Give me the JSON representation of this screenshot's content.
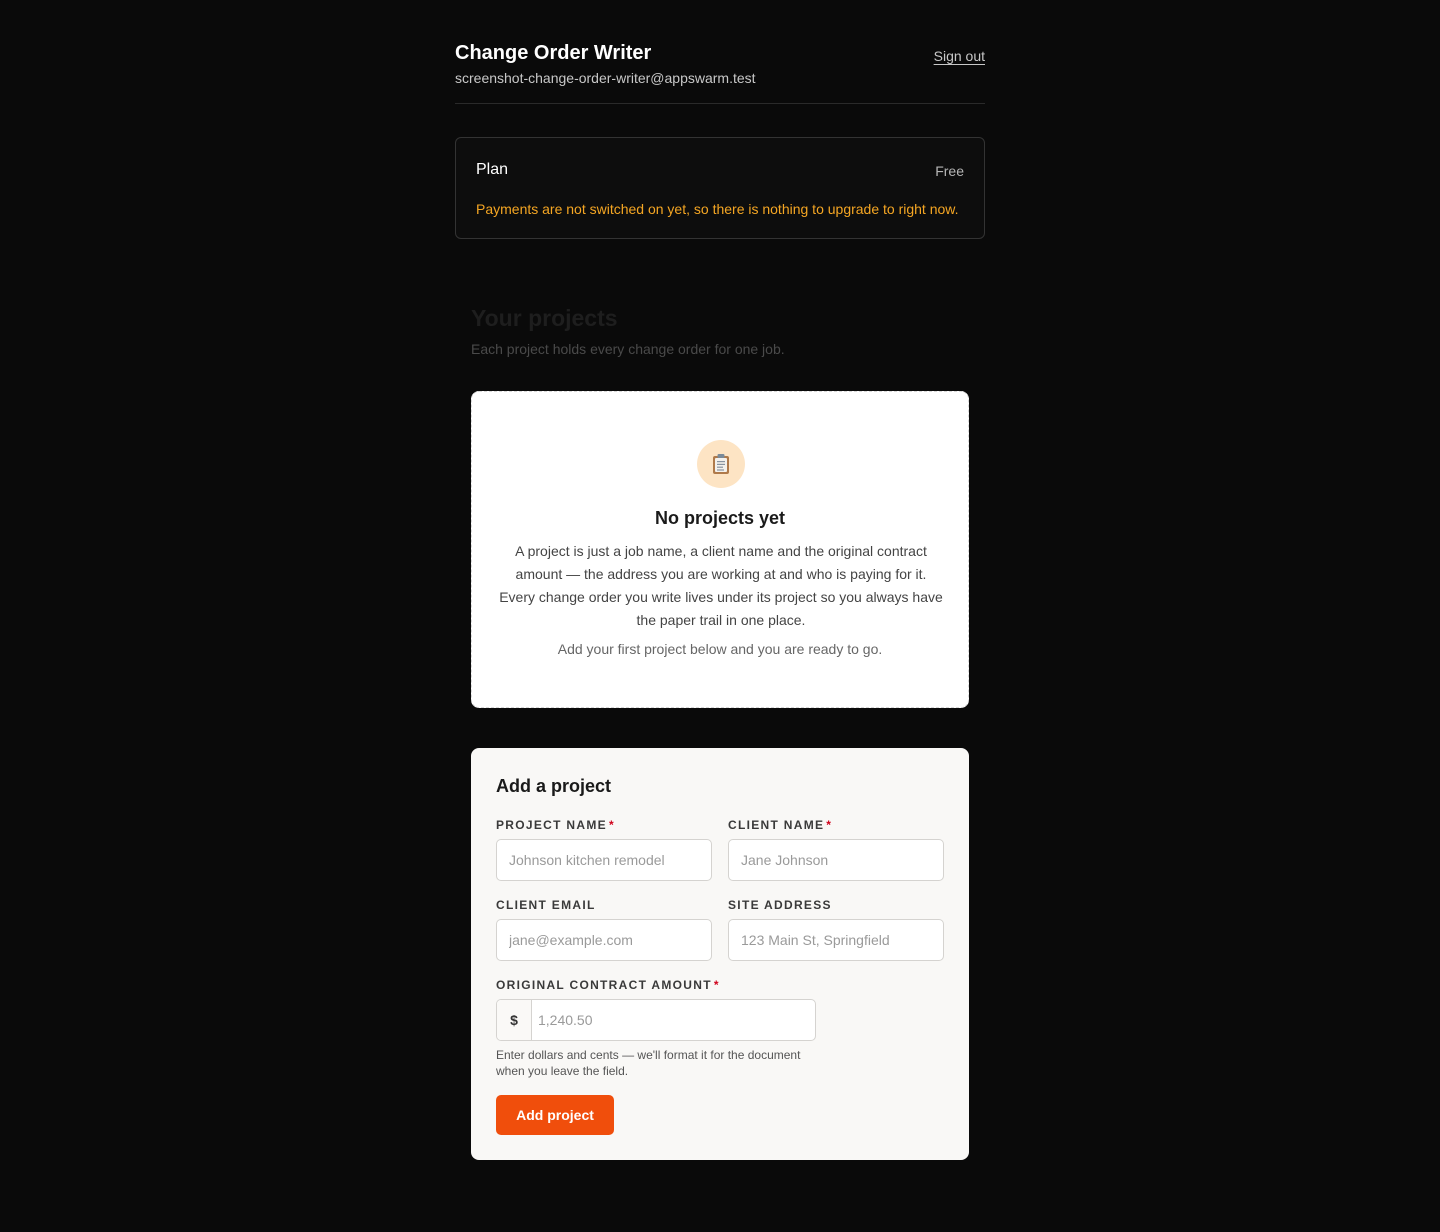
{
  "header": {
    "app_title": "Change Order Writer",
    "user_email": "screenshot-change-order-writer@appswarm.test",
    "sign_out_label": "Sign out"
  },
  "plan": {
    "label": "Plan",
    "value": "Free",
    "notice": "Payments are not switched on yet, so there is nothing to upgrade to right now.",
    "notice_color": "#f5a623"
  },
  "projects": {
    "title": "Your projects",
    "subtitle": "Each project holds every change order for one job.",
    "empty_state": {
      "icon": "clipboard-icon",
      "title": "No projects yet",
      "body": "A project is just a job name, a client name and the original contract amount — the address you are working at and who is paying for it. Every change order you write lives under its project so you always have the paper trail in one place.",
      "cta": "Add your first project below and you are ready to go."
    }
  },
  "form": {
    "title": "Add a project",
    "required_marker": "*",
    "fields": {
      "project_name": {
        "label": "PROJECT NAME",
        "placeholder": "Johnson kitchen remodel",
        "required": true
      },
      "client_name": {
        "label": "CLIENT NAME",
        "placeholder": "Jane Johnson",
        "required": true
      },
      "client_email": {
        "label": "CLIENT EMAIL",
        "placeholder": "jane@example.com",
        "required": false
      },
      "site_address": {
        "label": "SITE ADDRESS",
        "placeholder": "123 Main St, Springfield",
        "required": false
      },
      "contract_amount": {
        "label": "ORIGINAL CONTRACT AMOUNT",
        "prefix": "$",
        "placeholder": "1,240.50",
        "required": true,
        "hint": "Enter dollars and cents — we'll format it for the document when you leave the field."
      }
    },
    "submit_label": "Add project",
    "accent_color": "#f04e0c"
  }
}
